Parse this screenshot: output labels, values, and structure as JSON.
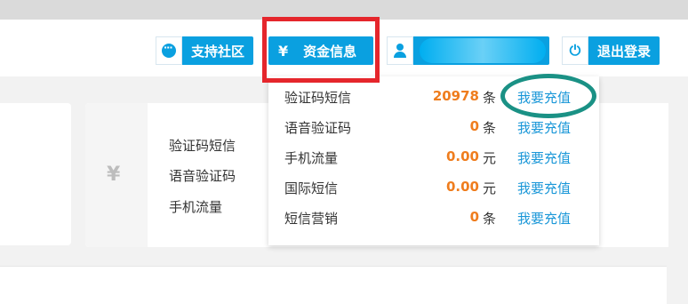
{
  "header": {
    "support_label": "支持社区",
    "funds_label": "资金信息",
    "funds_icon": "¥",
    "logout_label": "退出登录"
  },
  "dropdown": {
    "rows": [
      {
        "name": "验证码短信",
        "value": "20978",
        "unit": "条",
        "link": "我要充值"
      },
      {
        "name": "语音验证码",
        "value": "0",
        "unit": "条",
        "link": "我要充值"
      },
      {
        "name": "手机流量",
        "value": "0.00",
        "unit": "元",
        "link": "我要充值"
      },
      {
        "name": "国际短信",
        "value": "0.00",
        "unit": "元",
        "link": "我要充值"
      },
      {
        "name": "短信营销",
        "value": "0",
        "unit": "条",
        "link": "我要充值"
      }
    ]
  },
  "card": {
    "icon": "¥",
    "labels": [
      "验证码短信",
      "语音验证码",
      "手机流量"
    ]
  },
  "colors": {
    "accent": "#0aa0e0",
    "value_orange": "#ef7d1e",
    "link_blue": "#1a97d8",
    "highlight_red": "#e5262c",
    "highlight_teal": "#1a9185"
  }
}
